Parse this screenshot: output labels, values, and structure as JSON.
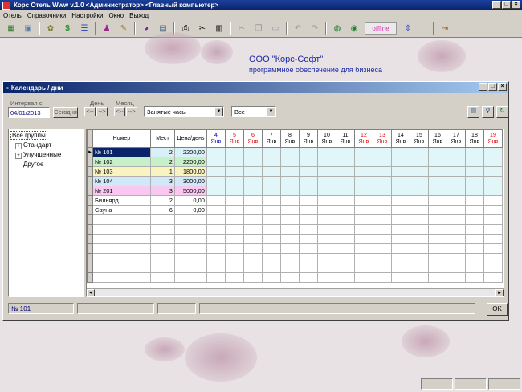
{
  "app_title": "Корс Отель Www v.1.0   <Администратор>   <Главный компьютер>",
  "menu": [
    "Отель",
    "Справочники",
    "Настройки",
    "Окно",
    "Выход"
  ],
  "toolbar": {
    "offline": "offline"
  },
  "company": {
    "name": "ООО \"Корс-Софт\"",
    "tagline": "программное обеспечение для бизнеса"
  },
  "window": {
    "title": "Календарь / дни",
    "interval_label": "Интервал с",
    "date_value": "04/01/2013",
    "today_btn": "Сегодня",
    "day_label": "День",
    "month_label": "Месяц",
    "nav_prev": "<--",
    "nav_next": "-->",
    "mode_select": "Занятые часы",
    "filter_select": "Все",
    "ok": "OK",
    "status_room": "№ 101"
  },
  "tree": [
    "Все группы",
    "Стандарт",
    "Улучшенные",
    "Другое"
  ],
  "grid": {
    "headers": [
      "Номер",
      "Мест",
      "Цена/день"
    ],
    "days": [
      {
        "d": "4",
        "m": "Янв",
        "c": "#0000c0"
      },
      {
        "d": "5",
        "m": "Янв",
        "c": "#e00000"
      },
      {
        "d": "6",
        "m": "Янв",
        "c": "#e00000"
      },
      {
        "d": "7",
        "m": "Янв",
        "c": "#000"
      },
      {
        "d": "8",
        "m": "Янв",
        "c": "#000"
      },
      {
        "d": "9",
        "m": "Янв",
        "c": "#000"
      },
      {
        "d": "10",
        "m": "Янв",
        "c": "#000"
      },
      {
        "d": "11",
        "m": "Янв",
        "c": "#000"
      },
      {
        "d": "12",
        "m": "Янв",
        "c": "#e00000"
      },
      {
        "d": "13",
        "m": "Янв",
        "c": "#e00000"
      },
      {
        "d": "14",
        "m": "Янв",
        "c": "#000"
      },
      {
        "d": "15",
        "m": "Янв",
        "c": "#000"
      },
      {
        "d": "16",
        "m": "Янв",
        "c": "#000"
      },
      {
        "d": "17",
        "m": "Янв",
        "c": "#000"
      },
      {
        "d": "18",
        "m": "Янв",
        "c": "#000"
      },
      {
        "d": "19",
        "m": "Янв",
        "c": "#e00000"
      }
    ],
    "rows": [
      {
        "name": "№ 101",
        "seats": "2",
        "price": "2200,00",
        "bg": "#d8f0f8",
        "sel": true
      },
      {
        "name": "№ 102",
        "seats": "2",
        "price": "2200,00",
        "bg": "#c8f0c8"
      },
      {
        "name": "№ 103",
        "seats": "1",
        "price": "1800,00",
        "bg": "#f8f4c0"
      },
      {
        "name": "№ 104",
        "seats": "3",
        "price": "3000,00",
        "bg": "#d0e8f8"
      },
      {
        "name": "№ 201",
        "seats": "3",
        "price": "5000,00",
        "bg": "#f8c8f0"
      },
      {
        "name": "Бильярд",
        "seats": "2",
        "price": "0,00",
        "bg": "#ffffff"
      },
      {
        "name": "Сауна",
        "seats": "6",
        "price": "0,00",
        "bg": "#ffffff"
      }
    ]
  }
}
